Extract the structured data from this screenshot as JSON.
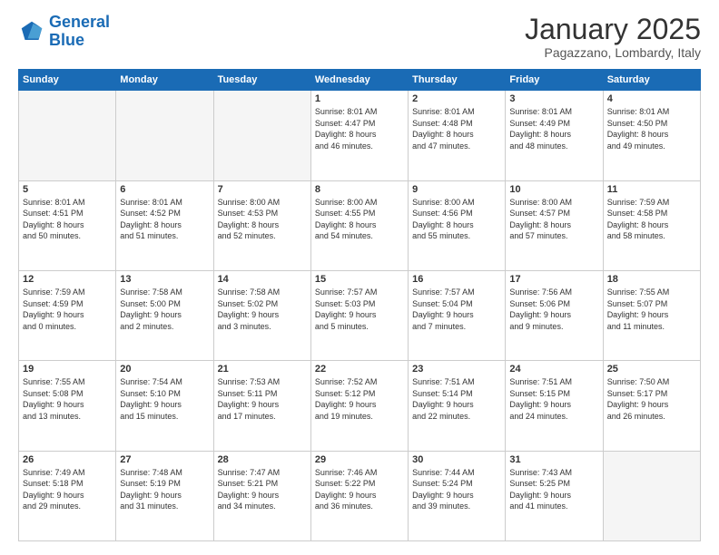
{
  "header": {
    "logo_line1": "General",
    "logo_line2": "Blue",
    "month": "January 2025",
    "location": "Pagazzano, Lombardy, Italy"
  },
  "weekdays": [
    "Sunday",
    "Monday",
    "Tuesday",
    "Wednesday",
    "Thursday",
    "Friday",
    "Saturday"
  ],
  "weeks": [
    [
      {
        "day": "",
        "info": ""
      },
      {
        "day": "",
        "info": ""
      },
      {
        "day": "",
        "info": ""
      },
      {
        "day": "1",
        "info": "Sunrise: 8:01 AM\nSunset: 4:47 PM\nDaylight: 8 hours\nand 46 minutes."
      },
      {
        "day": "2",
        "info": "Sunrise: 8:01 AM\nSunset: 4:48 PM\nDaylight: 8 hours\nand 47 minutes."
      },
      {
        "day": "3",
        "info": "Sunrise: 8:01 AM\nSunset: 4:49 PM\nDaylight: 8 hours\nand 48 minutes."
      },
      {
        "day": "4",
        "info": "Sunrise: 8:01 AM\nSunset: 4:50 PM\nDaylight: 8 hours\nand 49 minutes."
      }
    ],
    [
      {
        "day": "5",
        "info": "Sunrise: 8:01 AM\nSunset: 4:51 PM\nDaylight: 8 hours\nand 50 minutes."
      },
      {
        "day": "6",
        "info": "Sunrise: 8:01 AM\nSunset: 4:52 PM\nDaylight: 8 hours\nand 51 minutes."
      },
      {
        "day": "7",
        "info": "Sunrise: 8:00 AM\nSunset: 4:53 PM\nDaylight: 8 hours\nand 52 minutes."
      },
      {
        "day": "8",
        "info": "Sunrise: 8:00 AM\nSunset: 4:55 PM\nDaylight: 8 hours\nand 54 minutes."
      },
      {
        "day": "9",
        "info": "Sunrise: 8:00 AM\nSunset: 4:56 PM\nDaylight: 8 hours\nand 55 minutes."
      },
      {
        "day": "10",
        "info": "Sunrise: 8:00 AM\nSunset: 4:57 PM\nDaylight: 8 hours\nand 57 minutes."
      },
      {
        "day": "11",
        "info": "Sunrise: 7:59 AM\nSunset: 4:58 PM\nDaylight: 8 hours\nand 58 minutes."
      }
    ],
    [
      {
        "day": "12",
        "info": "Sunrise: 7:59 AM\nSunset: 4:59 PM\nDaylight: 9 hours\nand 0 minutes."
      },
      {
        "day": "13",
        "info": "Sunrise: 7:58 AM\nSunset: 5:00 PM\nDaylight: 9 hours\nand 2 minutes."
      },
      {
        "day": "14",
        "info": "Sunrise: 7:58 AM\nSunset: 5:02 PM\nDaylight: 9 hours\nand 3 minutes."
      },
      {
        "day": "15",
        "info": "Sunrise: 7:57 AM\nSunset: 5:03 PM\nDaylight: 9 hours\nand 5 minutes."
      },
      {
        "day": "16",
        "info": "Sunrise: 7:57 AM\nSunset: 5:04 PM\nDaylight: 9 hours\nand 7 minutes."
      },
      {
        "day": "17",
        "info": "Sunrise: 7:56 AM\nSunset: 5:06 PM\nDaylight: 9 hours\nand 9 minutes."
      },
      {
        "day": "18",
        "info": "Sunrise: 7:55 AM\nSunset: 5:07 PM\nDaylight: 9 hours\nand 11 minutes."
      }
    ],
    [
      {
        "day": "19",
        "info": "Sunrise: 7:55 AM\nSunset: 5:08 PM\nDaylight: 9 hours\nand 13 minutes."
      },
      {
        "day": "20",
        "info": "Sunrise: 7:54 AM\nSunset: 5:10 PM\nDaylight: 9 hours\nand 15 minutes."
      },
      {
        "day": "21",
        "info": "Sunrise: 7:53 AM\nSunset: 5:11 PM\nDaylight: 9 hours\nand 17 minutes."
      },
      {
        "day": "22",
        "info": "Sunrise: 7:52 AM\nSunset: 5:12 PM\nDaylight: 9 hours\nand 19 minutes."
      },
      {
        "day": "23",
        "info": "Sunrise: 7:51 AM\nSunset: 5:14 PM\nDaylight: 9 hours\nand 22 minutes."
      },
      {
        "day": "24",
        "info": "Sunrise: 7:51 AM\nSunset: 5:15 PM\nDaylight: 9 hours\nand 24 minutes."
      },
      {
        "day": "25",
        "info": "Sunrise: 7:50 AM\nSunset: 5:17 PM\nDaylight: 9 hours\nand 26 minutes."
      }
    ],
    [
      {
        "day": "26",
        "info": "Sunrise: 7:49 AM\nSunset: 5:18 PM\nDaylight: 9 hours\nand 29 minutes."
      },
      {
        "day": "27",
        "info": "Sunrise: 7:48 AM\nSunset: 5:19 PM\nDaylight: 9 hours\nand 31 minutes."
      },
      {
        "day": "28",
        "info": "Sunrise: 7:47 AM\nSunset: 5:21 PM\nDaylight: 9 hours\nand 34 minutes."
      },
      {
        "day": "29",
        "info": "Sunrise: 7:46 AM\nSunset: 5:22 PM\nDaylight: 9 hours\nand 36 minutes."
      },
      {
        "day": "30",
        "info": "Sunrise: 7:44 AM\nSunset: 5:24 PM\nDaylight: 9 hours\nand 39 minutes."
      },
      {
        "day": "31",
        "info": "Sunrise: 7:43 AM\nSunset: 5:25 PM\nDaylight: 9 hours\nand 41 minutes."
      },
      {
        "day": "",
        "info": ""
      }
    ]
  ]
}
